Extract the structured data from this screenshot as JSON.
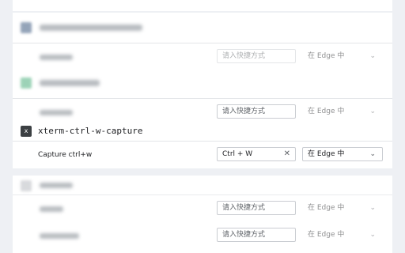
{
  "extensions": [
    {
      "name_hidden": true,
      "icon_color": "#3d5a80",
      "shortcuts": [
        {
          "placeholder": "请入快捷方式",
          "value": "",
          "scope": "在 Edge 中"
        }
      ]
    },
    {
      "name_hidden": true,
      "icon_color": "#4caf7d",
      "shortcuts": [
        {
          "placeholder": "请入快捷方式",
          "value": "",
          "scope": "在 Edge 中"
        }
      ]
    },
    {
      "name": "xterm-ctrl-w-capture",
      "icon_label": "x",
      "icon_color": "#3c4043",
      "shortcuts": [
        {
          "label": "Capture ctrl+w",
          "value": "Ctrl + W",
          "clear": "✕",
          "scope": "在 Edge 中"
        }
      ]
    },
    {
      "name_hidden": true,
      "icon_color": "#b9bcc1",
      "shortcuts": [
        {
          "placeholder": "请入快捷方式",
          "value": "",
          "scope": "在 Edge 中"
        },
        {
          "placeholder": "请入快捷方式",
          "value": "",
          "scope": "在 Edge 中"
        }
      ]
    }
  ],
  "icons": {
    "chevron": "chevron-down-icon",
    "clear": "close-icon"
  }
}
